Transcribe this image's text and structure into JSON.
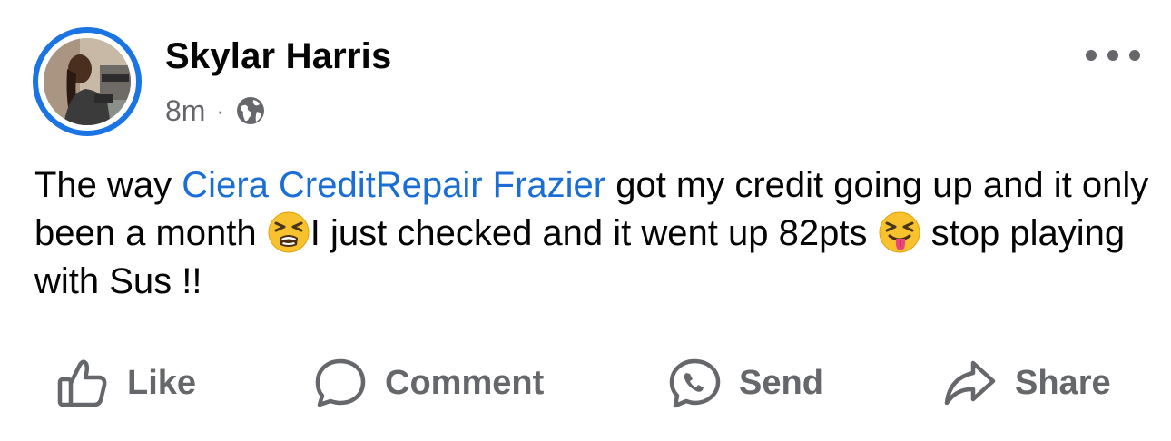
{
  "post": {
    "author": "Skylar Harris",
    "timestamp": "8m",
    "separator": "·",
    "privacy_icon": "globe-icon",
    "more_icon": "more-horizontal-icon",
    "text": {
      "part1": "The way ",
      "mention": "Ciera CreditRepair Frazier",
      "part2": " got my credit going up and it only been a month ",
      "emoji1": "tired-face-emoji",
      "part3": "I just checked and it went up 82pts ",
      "emoji2": "squinting-tongue-emoji",
      "part4": " stop playing with Sus !!"
    }
  },
  "actions": [
    {
      "label": "Like",
      "icon": "thumbs-up-icon"
    },
    {
      "label": "Comment",
      "icon": "comment-bubble-icon"
    },
    {
      "label": "Send",
      "icon": "messenger-icon"
    },
    {
      "label": "Share",
      "icon": "share-arrow-icon"
    }
  ],
  "colors": {
    "accent": "#1b74e4",
    "mention": "#1b6ed6",
    "secondary_text": "#65676b",
    "primary_text": "#050505"
  }
}
